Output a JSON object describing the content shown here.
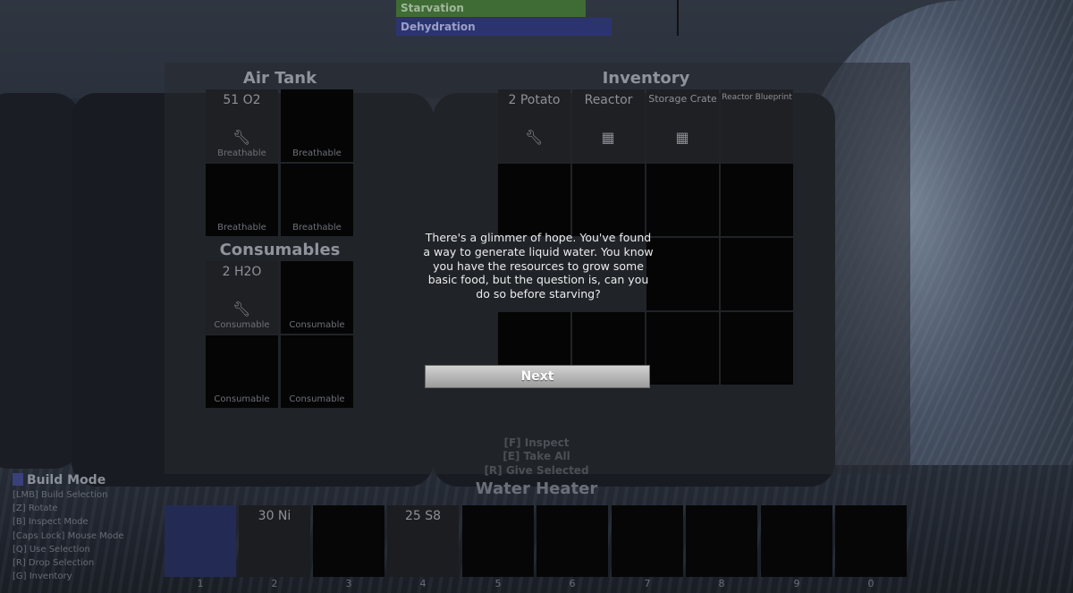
{
  "status_bars": {
    "starvation": "Starvation",
    "dehydration": "Dehydration"
  },
  "air_tank": {
    "title": "Air Tank",
    "slots": [
      {
        "qty": "51 O2",
        "icon": "wrench-icon",
        "label": "Breathable"
      },
      {
        "qty": "",
        "icon": "",
        "label": "Breathable"
      },
      {
        "qty": "",
        "icon": "",
        "label": "Breathable"
      },
      {
        "qty": "",
        "icon": "",
        "label": "Breathable"
      }
    ]
  },
  "consumables": {
    "title": "Consumables",
    "slots": [
      {
        "qty": "2 H2O",
        "icon": "wrench-icon",
        "label": "Consumable"
      },
      {
        "qty": "",
        "icon": "",
        "label": "Consumable"
      },
      {
        "qty": "",
        "icon": "",
        "label": "Consumable"
      },
      {
        "qty": "",
        "icon": "",
        "label": "Consumable"
      }
    ]
  },
  "inventory": {
    "title": "Inventory",
    "items": [
      {
        "qty": "2 Potato",
        "icon": "wrench-icon"
      },
      {
        "qty": "Reactor",
        "icon": "building-icon"
      },
      {
        "qty": "Storage Crate",
        "icon": "building-icon"
      },
      {
        "qty": "Reactor Blueprint",
        "icon": ""
      }
    ]
  },
  "dialog": {
    "text": "There's a glimmer of hope. You've found a way to generate liquid water. You know you have the resources to grow some basic food, but the question is, can you do so before starving?",
    "next_label": "Next"
  },
  "hints": {
    "inspect": "[F] Inspect",
    "take_all": "[E] Take All",
    "give_selected": "[R] Give Selected"
  },
  "target_name": "Water Heater",
  "build_mode": {
    "title": "Build Mode",
    "lines": [
      "[LMB] Build Selection",
      "[Z] Rotate",
      "[B] Inspect Mode",
      "[Caps Lock] Mouse Mode",
      "[Q] Use Selection",
      "[R] Drop Selection",
      "[G] Inventory"
    ]
  },
  "hotbar": [
    {
      "num": "1",
      "qty": ""
    },
    {
      "num": "2",
      "qty": "30 Ni"
    },
    {
      "num": "3",
      "qty": ""
    },
    {
      "num": "4",
      "qty": "25 S8"
    },
    {
      "num": "5",
      "qty": ""
    },
    {
      "num": "6",
      "qty": ""
    },
    {
      "num": "7",
      "qty": ""
    },
    {
      "num": "8",
      "qty": ""
    },
    {
      "num": "9",
      "qty": ""
    },
    {
      "num": "0",
      "qty": ""
    }
  ],
  "colors": {
    "hotbar_selected": "#232b55",
    "starvation_bar": "#3f6b35",
    "dehydration_bar": "#2c3470"
  }
}
